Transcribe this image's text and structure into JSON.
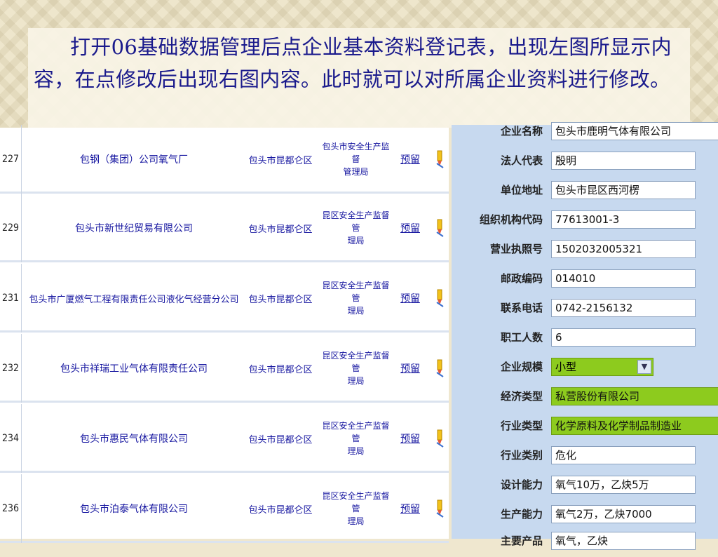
{
  "header": {
    "text": "打开06基础数据管理后点企业基本资料登记表，出现左图所显示内容，在点修改后出现右图内容。此时就可以对所属企业资料进行修改。"
  },
  "table": {
    "rows": [
      {
        "id": "227",
        "name": "包钢（集团）公司氧气厂",
        "region": "包头市昆都仑区",
        "agency": "包头市安全生产监督\n管理局",
        "action": "预留"
      },
      {
        "id": "229",
        "name": "包头市新世纪贸易有限公司",
        "region": "包头市昆都仑区",
        "agency": "昆区安全生产监督管\n理局",
        "action": "预留"
      },
      {
        "id": "231",
        "name": "包头市广厦燃气工程有限责任公司液化气经营分公司",
        "region": "包头市昆都仑区",
        "agency": "昆区安全生产监督管\n理局",
        "action": "预留"
      },
      {
        "id": "232",
        "name": "包头市祥瑞工业气体有限责任公司",
        "region": "包头市昆都仑区",
        "agency": "昆区安全生产监督管\n理局",
        "action": "预留"
      },
      {
        "id": "234",
        "name": "包头市惠民气体有限公司",
        "region": "包头市昆都仑区",
        "agency": "昆区安全生产监督管\n理局",
        "action": "预留"
      },
      {
        "id": "236",
        "name": "包头市泊泰气体有限公司",
        "region": "包头市昆都仑区",
        "agency": "昆区安全生产监督管\n理局",
        "action": "预留"
      }
    ]
  },
  "form": {
    "fields": [
      {
        "label": "企业名称",
        "value": "包头市鹿明气体有限公司"
      },
      {
        "label": "法人代表",
        "value": "殷明"
      },
      {
        "label": "单位地址",
        "value": "包头市昆区西河楞"
      },
      {
        "label": "组织机构代码",
        "value": "77613001-3"
      },
      {
        "label": "营业执照号",
        "value": "1502032005321"
      },
      {
        "label": "邮政编码",
        "value": "014010"
      },
      {
        "label": "联系电话",
        "value": "0742-2156132"
      },
      {
        "label": "职工人数",
        "value": "6"
      },
      {
        "label": "企业规模",
        "value": "小型"
      },
      {
        "label": "经济类型",
        "value": "私营股份有限公司"
      },
      {
        "label": "行业类型",
        "value": "化学原料及化学制品制造业"
      },
      {
        "label": "行业类别",
        "value": "危化"
      },
      {
        "label": "设计能力",
        "value": "氧气10万，乙炔5万"
      },
      {
        "label": "生产能力",
        "value": "氧气2万，乙炔7000"
      },
      {
        "label": "主要产品",
        "value": "氧气，乙炔"
      }
    ]
  },
  "colors": {
    "header_text": "#1a1a8c",
    "table_text": "#1616a0",
    "form_bg": "#c7d9ef",
    "highlight_green": "#8dcb1e"
  }
}
